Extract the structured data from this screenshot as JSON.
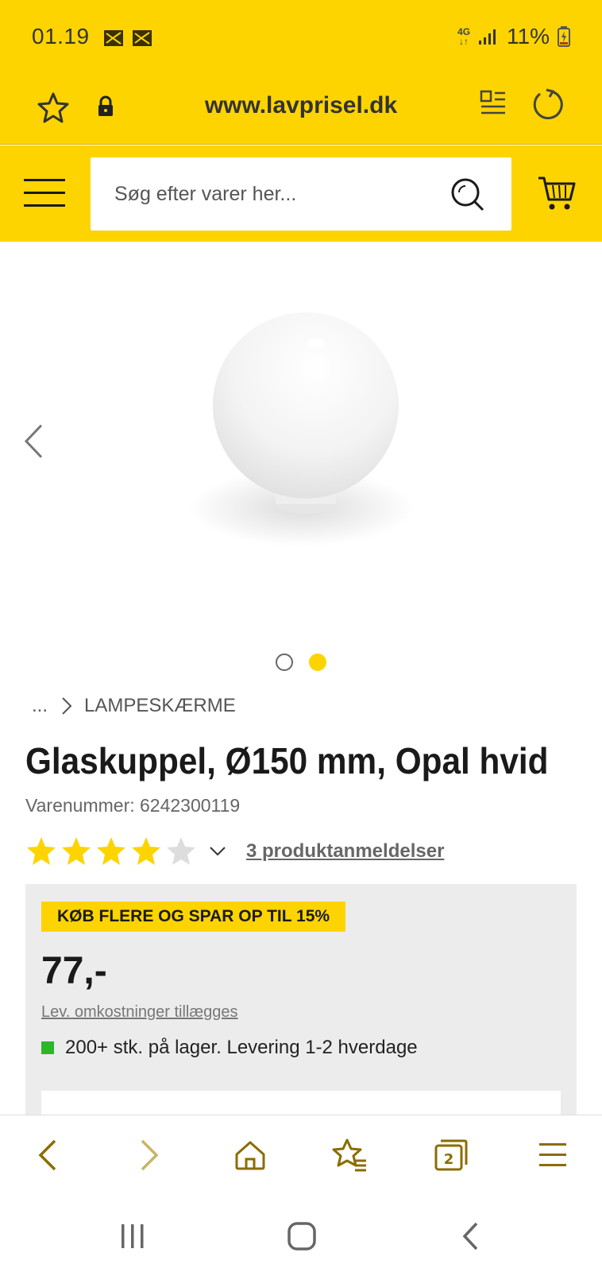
{
  "status_bar": {
    "time": "01.19",
    "network": "4G",
    "battery": "11%"
  },
  "address_bar": {
    "url": "www.lavprisel.dk"
  },
  "header": {
    "search_placeholder": "Søg efter varer her..."
  },
  "gallery": {
    "image_count": 2,
    "active_index": 1
  },
  "breadcrumb": {
    "ellipsis": "...",
    "category": "LAMPESKÆRME"
  },
  "product": {
    "title": "Glaskuppel, Ø150 mm, Opal hvid",
    "sku_label": "Varenummer:",
    "sku": "6242300119",
    "rating": 4,
    "rating_max": 5,
    "reviews_link": "3 produktanmeldelser",
    "promo": "KØB FLERE OG SPAR OP TIL 15%",
    "price": "77,-",
    "delivery_cost": "Lev. omkostninger tillægges",
    "stock": "200+ stk. på lager. Levering 1-2 hverdage"
  },
  "colors": {
    "brand_yellow": "#fdd400",
    "star_filled": "#fdd400",
    "star_empty": "#dddddd",
    "in_stock": "#2db52d",
    "browser_icon": "#8a6d00"
  },
  "icons": {
    "status": [
      "notification-icon",
      "notification-icon",
      "signal-icon",
      "battery-charging-icon"
    ],
    "address_bar": [
      "bookmark-star-icon",
      "lock-icon",
      "reader-mode-icon",
      "reload-icon"
    ],
    "header": [
      "hamburger-menu-icon",
      "search-icon",
      "cart-icon"
    ],
    "gallery": [
      "chevron-left-icon"
    ],
    "browser_bar": [
      "back-icon",
      "forward-icon",
      "home-icon",
      "bookmarks-icon",
      "tabs-icon",
      "menu-icon"
    ],
    "system_nav": [
      "recent-apps-icon",
      "home-button-icon",
      "system-back-icon"
    ]
  },
  "browser_bar": {
    "tab_count": "2"
  }
}
